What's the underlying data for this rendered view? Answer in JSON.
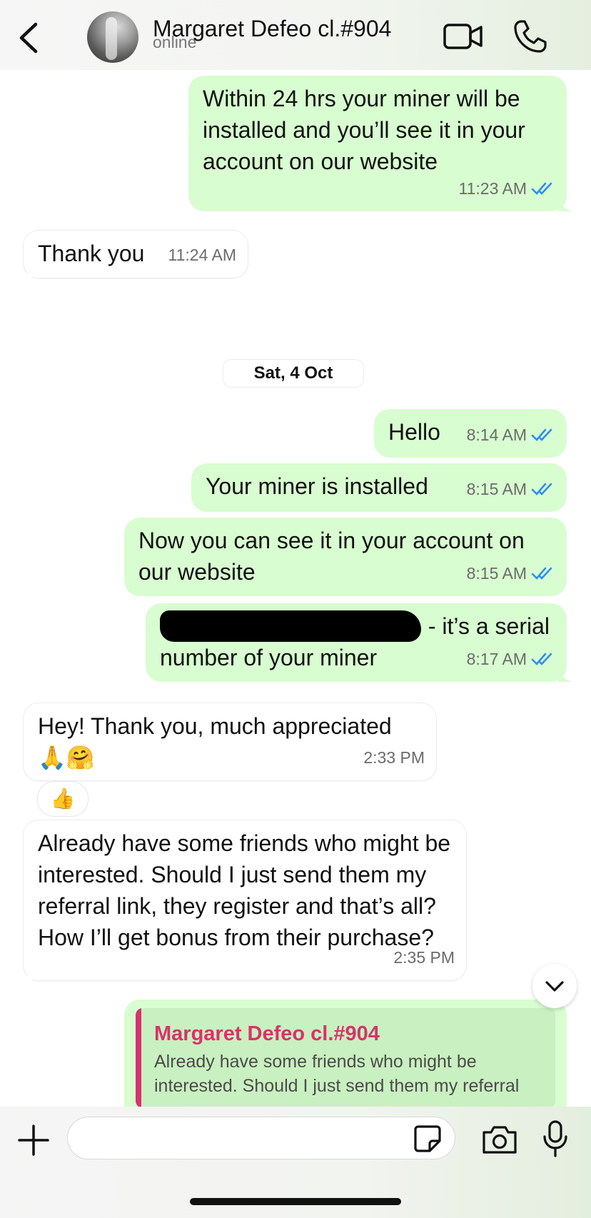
{
  "header": {
    "back_icon": "chevron-left-icon",
    "contact_name": "Margaret Defeo cl.#904",
    "status": "online",
    "video_icon": "video-camera-icon",
    "call_icon": "phone-icon"
  },
  "messages": [
    {
      "dir": "out",
      "text": "Within 24 hrs your miner will be installed and you’ll see it in your account on our website",
      "time": "11:23 AM",
      "read": true
    },
    {
      "dir": "in",
      "text": "Thank you",
      "time": "11:24 AM"
    },
    {
      "dir": "out",
      "text": "Hello",
      "time": "8:14 AM",
      "read": true
    },
    {
      "dir": "out",
      "text": "Your miner is installed",
      "time": "8:15 AM",
      "read": true
    },
    {
      "dir": "out",
      "text": "Now you can see it in your account on our website",
      "time": "8:15 AM",
      "read": true
    },
    {
      "dir": "out",
      "text_suffix": "- it’s a serial",
      "text_line2": "number of your miner",
      "time": "8:17 AM",
      "read": true,
      "redacted": true
    },
    {
      "dir": "in",
      "text": "Hey! Thank you, much appreciated",
      "emoji": "🙏🤗",
      "time": "2:33 PM",
      "reaction": "👍"
    },
    {
      "dir": "in",
      "text": "Already have some friends who might be interested. Should I just send them my referral link, they register and that’s all? How I’ll get bonus from their purchase?",
      "time": "2:35 PM"
    }
  ],
  "date_separator": "Sat, 4 Oct",
  "reply_preview": {
    "name": "Margaret Defeo cl.#904",
    "text": "Already have some friends who might be interested. Should I just send them my referral"
  },
  "input": {
    "placeholder": "",
    "plus_icon": "plus-icon",
    "sticker_icon": "sticker-icon",
    "camera_icon": "camera-icon",
    "mic_icon": "microphone-icon"
  },
  "colors": {
    "outgoing_bubble": "#d8fdd0",
    "incoming_bubble": "#ffffff",
    "read_ticks": "#2e8ef0",
    "quote_accent": "#d6336c"
  }
}
